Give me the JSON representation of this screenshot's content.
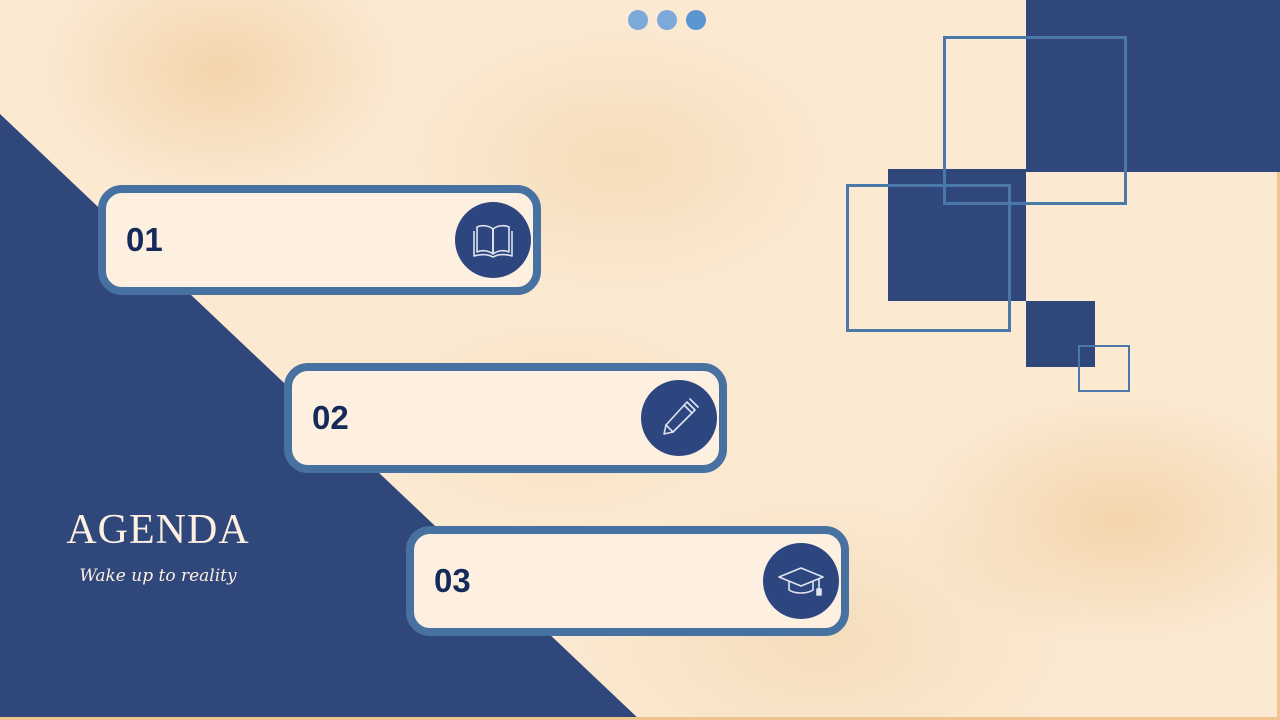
{
  "slide": {
    "title": "AGENDA",
    "subtitle": "Wake up to reality"
  },
  "pager": {
    "dot_count": 3
  },
  "items": [
    {
      "number": "01",
      "icon": "book-icon"
    },
    {
      "number": "02",
      "icon": "pen-icon"
    },
    {
      "number": "03",
      "icon": "graduation-cap-icon"
    }
  ],
  "colors": {
    "navy": "#30477c",
    "card_border": "#4671a0",
    "card_fill": "#fdf0e1",
    "number_text": "#15295a",
    "pager_dot": "#7aa9da",
    "background": "#fbe9d2"
  }
}
